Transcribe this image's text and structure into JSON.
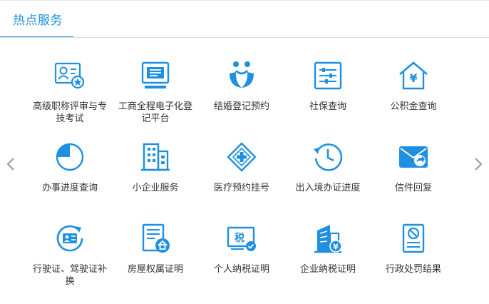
{
  "header": {
    "tab_label": "热点服务"
  },
  "colors": {
    "accent": "#1e8fe1",
    "text": "#333333",
    "divider": "#dcdcdc"
  },
  "nav": {
    "prev_icon": "chevron-left-icon",
    "next_icon": "chevron-right-icon"
  },
  "services": [
    {
      "label": "高级职称评审与专技考试",
      "icon": "certificate-star-icon"
    },
    {
      "label": "工商全程电子化登记平台",
      "icon": "monitor-icon"
    },
    {
      "label": "结婚登记预约",
      "icon": "couple-icon"
    },
    {
      "label": "社保查询",
      "icon": "sliders-icon"
    },
    {
      "label": "公积金查询",
      "icon": "house-yen-icon"
    },
    {
      "label": "办事进度查询",
      "icon": "progress-pie-icon"
    },
    {
      "label": "小企业服务",
      "icon": "building-icon"
    },
    {
      "label": "医疗预约挂号",
      "icon": "medical-cross-icon"
    },
    {
      "label": "出入境办证进度",
      "icon": "clock-history-icon"
    },
    {
      "label": "信件回复",
      "icon": "mail-reply-icon"
    },
    {
      "label": "行驶证、驾驶证补换",
      "icon": "license-card-icon"
    },
    {
      "label": "房屋权属证明",
      "icon": "house-document-icon"
    },
    {
      "label": "个人纳税证明",
      "icon": "tax-check-icon"
    },
    {
      "label": "企业纳税证明",
      "icon": "enterprise-tax-icon"
    },
    {
      "label": "行政处罚结果",
      "icon": "penalty-document-icon"
    }
  ]
}
